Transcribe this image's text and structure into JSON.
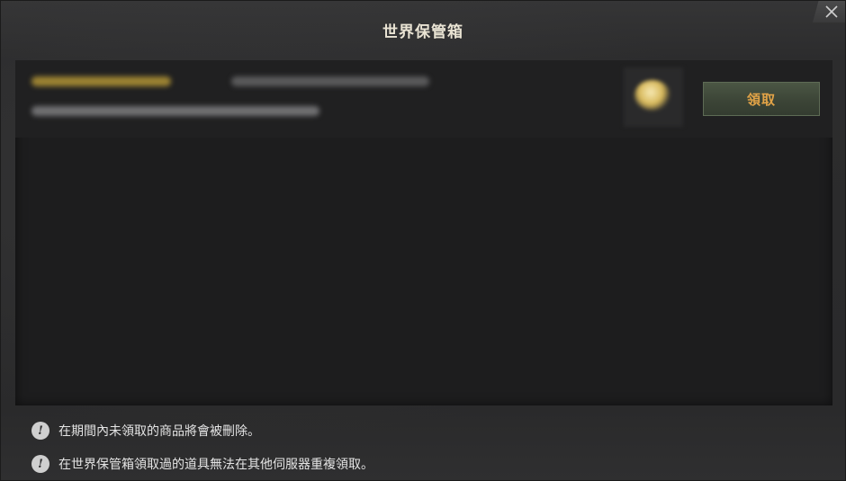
{
  "dialog": {
    "title": "世界保管箱"
  },
  "item": {
    "claim_label": "領取"
  },
  "notes": [
    {
      "icon": "!",
      "text": "在期間內未領取的商品將會被刪除。"
    },
    {
      "icon": "!",
      "text": "在世界保管箱領取過的道具無法在其他伺服器重複領取。"
    }
  ],
  "colors": {
    "title_text": "#e9e3d3",
    "claim_text": "#e2a347",
    "claim_button_bg": "#3c4537",
    "panel_bg": "#1d1d1e",
    "window_bg": "#2a2a2b"
  }
}
